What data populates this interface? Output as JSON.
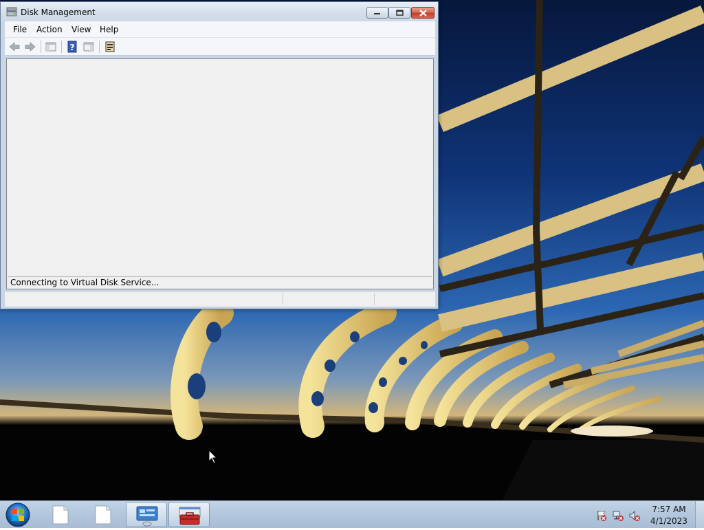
{
  "window": {
    "title": "Disk Management",
    "menu": [
      "File",
      "Action",
      "View",
      "Help"
    ],
    "status_message": "Connecting to Virtual Disk Service...",
    "toolbar_icons": [
      "back-arrow-icon",
      "forward-arrow-icon",
      "show-hide-console-tree-icon",
      "help-icon",
      "show-action-pane-icon",
      "properties-icon"
    ]
  },
  "taskbar": {
    "items": [
      "start-orb",
      "blank-document-1",
      "blank-document-2",
      "server-manager",
      "computer-management"
    ],
    "clock": {
      "time": "7:57 AM",
      "date": "4/1/2023"
    }
  },
  "colors": {
    "titlebar": "#d6e1ec",
    "close_button": "#c3412b",
    "content_bg": "#f0f0f0",
    "taskbar": "#b2c6dc",
    "sky_dark": "#0a1f4a",
    "bridge_gold": "#e8d27a"
  }
}
